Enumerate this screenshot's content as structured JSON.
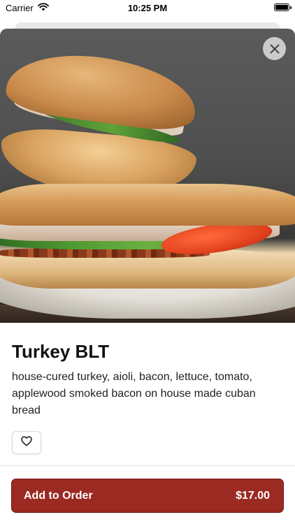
{
  "status_bar": {
    "carrier": "Carrier",
    "time": "10:25 PM",
    "wifi_icon": "wifi-icon",
    "battery_icon": "battery-icon"
  },
  "item": {
    "name": "Turkey BLT",
    "description": "house-cured turkey, aioli, bacon, lettuce, tomato, applewood smoked bacon on house made cuban bread",
    "image": "turkey-blt-sandwich-photo"
  },
  "icons": {
    "close": "close-icon",
    "favorite": "heart-icon"
  },
  "order_button": {
    "label": "Add to Order",
    "price": "$17.00"
  },
  "colors": {
    "accent": "#9b2a22"
  }
}
